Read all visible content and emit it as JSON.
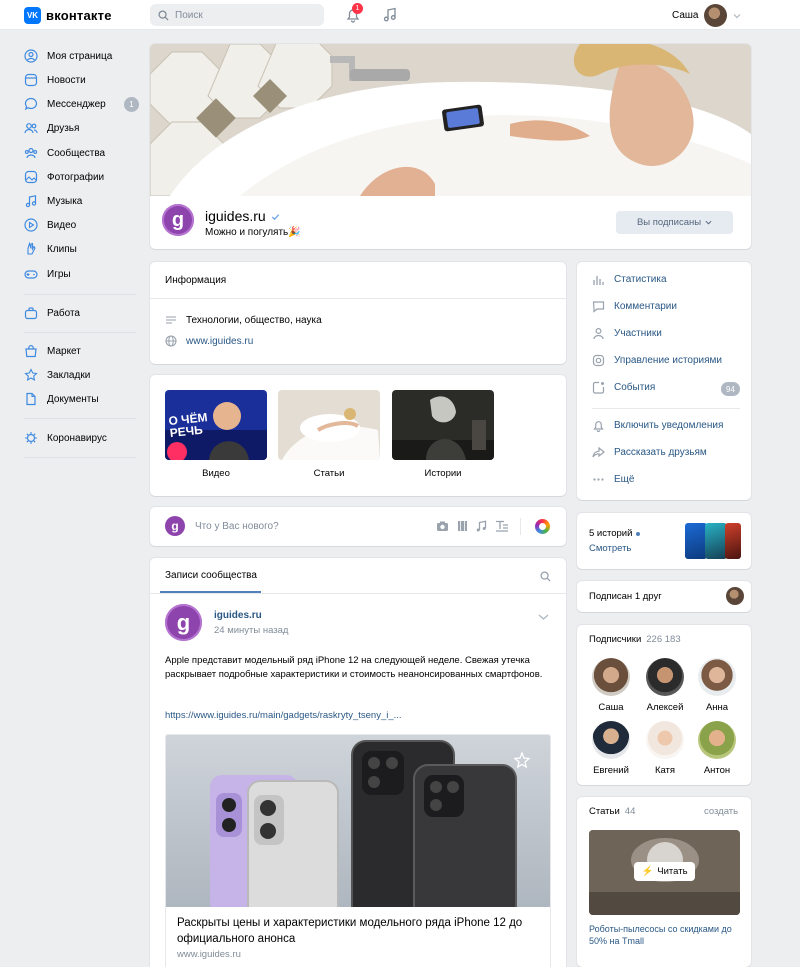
{
  "header": {
    "logo_text": "вконтакте",
    "logo_mark": "VK",
    "search_placeholder": "Поиск",
    "notifications_count": "1",
    "user_name": "Саша"
  },
  "sidebar": {
    "items": [
      {
        "label": "Моя страница",
        "icon": "user-circle-icon"
      },
      {
        "label": "Новости",
        "icon": "news-icon"
      },
      {
        "label": "Мессенджер",
        "icon": "message-icon",
        "count": "1"
      },
      {
        "label": "Друзья",
        "icon": "friends-icon"
      },
      {
        "label": "Сообщества",
        "icon": "communities-icon"
      },
      {
        "label": "Фотографии",
        "icon": "photo-icon"
      },
      {
        "label": "Музыка",
        "icon": "music-icon"
      },
      {
        "label": "Видео",
        "icon": "video-icon"
      },
      {
        "label": "Клипы",
        "icon": "clips-icon"
      },
      {
        "label": "Игры",
        "icon": "games-icon"
      },
      {
        "label": "Работа",
        "icon": "work-icon"
      },
      {
        "label": "Маркет",
        "icon": "market-icon"
      },
      {
        "label": "Закладки",
        "icon": "star-icon"
      },
      {
        "label": "Документы",
        "icon": "document-icon"
      },
      {
        "label": "Коронавирус",
        "icon": "virus-icon"
      }
    ]
  },
  "group": {
    "name": "iguides.ru",
    "status": "Можно и погулять🎉",
    "subscribe_button": "Вы подписаны",
    "avatar_letter": "g"
  },
  "info": {
    "title": "Информация",
    "topics": "Технологии, общество, наука",
    "website": "www.iguides.ru"
  },
  "media": {
    "video_label": "Видео",
    "articles_label": "Статьи",
    "stories_label": "Истории",
    "video_overlay": "О ЧЁМ РЕЧЬ"
  },
  "composer": {
    "placeholder": "Что у Вас нового?"
  },
  "posts": {
    "tab_label": "Записи сообщества",
    "post": {
      "author": "iguides.ru",
      "time": "24 минуты назад",
      "text": "Apple представит модельный ряд iPhone 12 на следующей неделе. Свежая утечка раскрывает подробные характеристики и стоимость неанонсированных смартфонов.",
      "link": "https://www.iguides.ru/main/gadgets/raskryty_tseny_i_...",
      "snippet_title": "Раскрыты цены и характеристики модельного ряда iPhone 12 до официального анонса",
      "snippet_domain": "www.iguides.ru"
    }
  },
  "actions": {
    "items": [
      {
        "label": "Статистика",
        "icon": "stats-icon"
      },
      {
        "label": "Комментарии",
        "icon": "comment-icon"
      },
      {
        "label": "Участники",
        "icon": "members-icon"
      },
      {
        "label": "Управление историями",
        "icon": "stories-icon"
      },
      {
        "label": "События",
        "icon": "events-icon",
        "count": "94"
      },
      {
        "label": "Включить уведомления",
        "icon": "bell-icon"
      },
      {
        "label": "Рассказать друзьям",
        "icon": "share-icon"
      },
      {
        "label": "Ещё",
        "icon": "more-icon"
      }
    ]
  },
  "stories": {
    "count_text": "5 историй",
    "watch": "Смотреть"
  },
  "friends": {
    "text": "Подписан 1 друг"
  },
  "subscribers": {
    "title": "Подписчики",
    "count": "226 183",
    "people": [
      "Саша",
      "Алексей",
      "Анна",
      "Евгений",
      "Катя",
      "Антон"
    ]
  },
  "articles": {
    "title": "Статьи",
    "count": "44",
    "create": "создать",
    "read_button": "Читать",
    "caption": "Роботы-пылесосы со скидками до 50% на Tmall"
  },
  "colors": {
    "accent": "#2a5885",
    "vk_blue": "#0077ff",
    "badge_red": "#ff3347",
    "avatar_purple": "#8e44ad"
  }
}
